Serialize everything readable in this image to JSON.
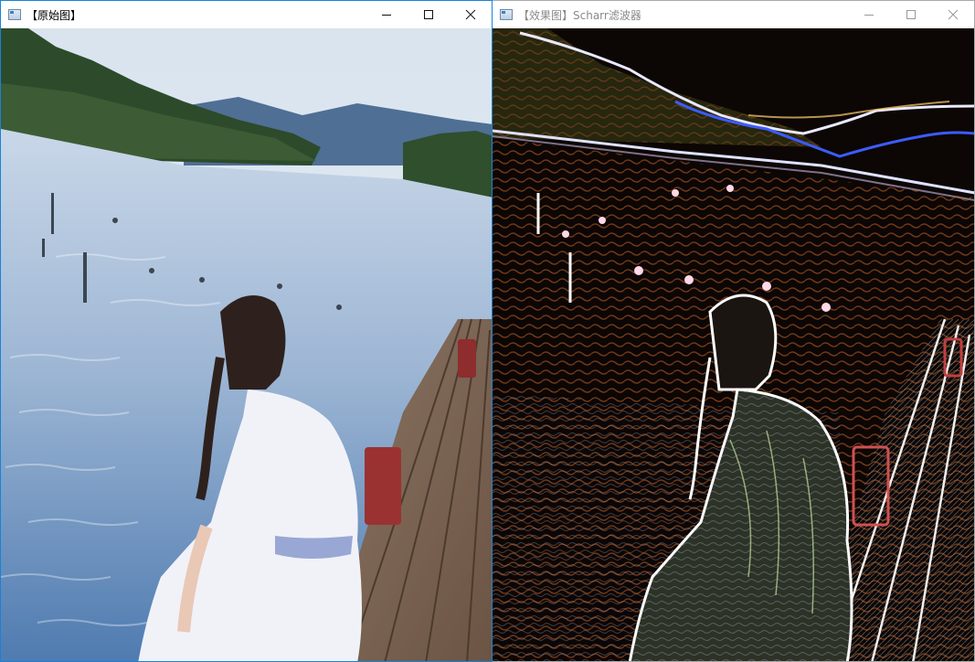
{
  "windows": [
    {
      "title": "【原始图】",
      "active": true,
      "icon": "opencv-window-icon",
      "controls": [
        "minimize-icon",
        "maximize-icon",
        "close-icon"
      ]
    },
    {
      "title": "【效果图】Scharr滤波器",
      "active": false,
      "icon": "opencv-window-icon",
      "controls": [
        "minimize-icon",
        "maximize-icon",
        "close-icon"
      ]
    }
  ],
  "images": {
    "original": "photo: girl in white dress sitting on wooden pier by a lake, mountains and trees",
    "effect": "Scharr edge-filter output of the same photo on black background"
  },
  "colors": {
    "active_border": "#1883d7",
    "inactive_title": "#8a8a8a",
    "sky": "#dfe8f2",
    "water": "#7fa2c9",
    "edge_background": "#0c0604"
  }
}
